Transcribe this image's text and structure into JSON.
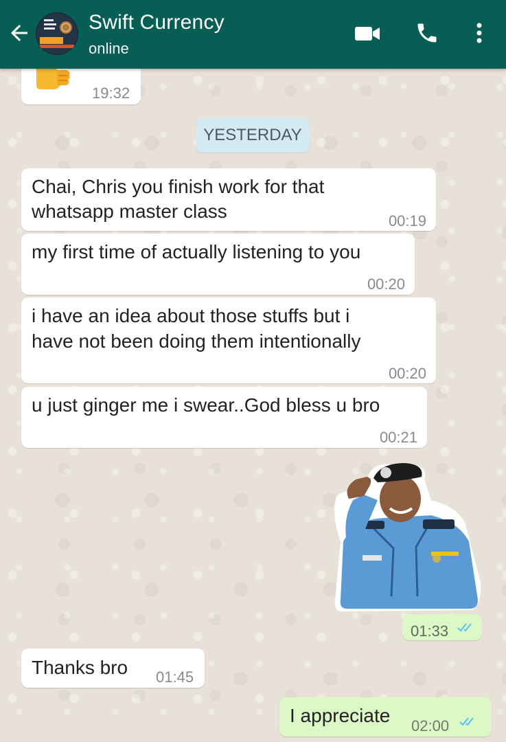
{
  "header": {
    "contact_name": "Swift Currency",
    "status": "online",
    "bg_color": "#075e54"
  },
  "icons": {
    "back": "arrow-left-icon",
    "video": "video-camera-icon",
    "call": "phone-icon",
    "menu": "more-vert-icon"
  },
  "chat": {
    "date_chip": "YESTERDAY",
    "messages": [
      {
        "direction": "in",
        "content": "thumbs-up emoji",
        "time": "19:32"
      },
      {
        "direction": "in",
        "lines": [
          "Chai, Chris you finish work for that",
          "whatsapp master class"
        ],
        "time": "00:19"
      },
      {
        "direction": "in",
        "lines": [
          "my first time of actually listening to you"
        ],
        "time": "00:20"
      },
      {
        "direction": "in",
        "lines": [
          "i have an idea about those stuffs but i",
          "have not been doing them intentionally"
        ],
        "time": "00:20"
      },
      {
        "direction": "in",
        "lines": [
          "u just ginger me i swear..God bless u bro"
        ],
        "time": "00:21"
      },
      {
        "direction": "out",
        "content": "saluting police officer sticker",
        "time": "01:33",
        "status": "read"
      },
      {
        "direction": "in",
        "lines": [
          "Thanks bro"
        ],
        "time": "01:45"
      },
      {
        "direction": "out",
        "lines": [
          "I appreciate"
        ],
        "time": "02:00",
        "status": "read"
      }
    ]
  },
  "colors": {
    "incoming_bubble": "#ffffff",
    "outgoing_bubble": "#dcf8c6",
    "read_ticks": "#4fc3f7",
    "date_chip": "#d3eaf4"
  }
}
